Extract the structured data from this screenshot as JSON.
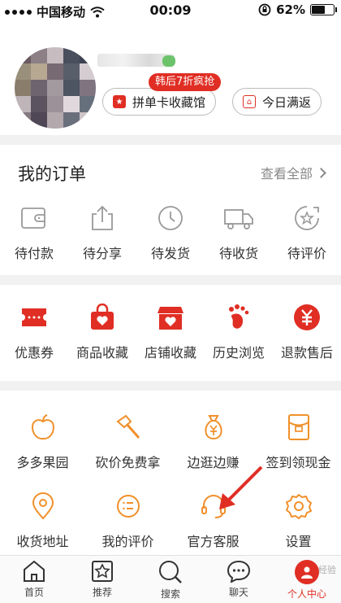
{
  "status_bar": {
    "carrier": "中国移动",
    "time": "00:09",
    "battery": "62%",
    "battery_level": 0.62
  },
  "profile": {
    "promo_tag": "韩后7折疯抢",
    "buttons": [
      {
        "label": "拼单卡收藏馆",
        "icon": "card-icon"
      },
      {
        "label": "今日满返",
        "icon": "gift-box-icon"
      }
    ]
  },
  "orders": {
    "title": "我的订单",
    "view_all": "查看全部",
    "items": [
      {
        "label": "待付款",
        "icon": "wallet-icon"
      },
      {
        "label": "待分享",
        "icon": "share-icon"
      },
      {
        "label": "待发货",
        "icon": "clock-icon"
      },
      {
        "label": "待收货",
        "icon": "truck-icon"
      },
      {
        "label": "待评价",
        "icon": "review-icon"
      }
    ]
  },
  "quick_links": [
    {
      "label": "优惠券",
      "icon": "coupon-icon"
    },
    {
      "label": "商品收藏",
      "icon": "bag-heart-icon"
    },
    {
      "label": "店铺收藏",
      "icon": "shop-heart-icon"
    },
    {
      "label": "历史浏览",
      "icon": "footprint-icon"
    },
    {
      "label": "退款售后",
      "icon": "refund-icon"
    }
  ],
  "services": [
    {
      "label": "多多果园",
      "icon": "apple-icon"
    },
    {
      "label": "砍价免费拿",
      "icon": "axe-icon"
    },
    {
      "label": "边逛边赚",
      "icon": "money-bag-icon"
    },
    {
      "label": "签到领现金",
      "icon": "red-envelope-icon"
    },
    {
      "label": "收货地址",
      "icon": "location-icon"
    },
    {
      "label": "我的评价",
      "icon": "comment-icon"
    },
    {
      "label": "官方客服",
      "icon": "headset-icon"
    },
    {
      "label": "设置",
      "icon": "gear-icon"
    }
  ],
  "tabbar": [
    {
      "label": "首页",
      "icon": "home-icon"
    },
    {
      "label": "推荐",
      "icon": "recommend-icon"
    },
    {
      "label": "搜索",
      "icon": "search-icon"
    },
    {
      "label": "聊天",
      "icon": "chat-icon"
    },
    {
      "label": "个人中心",
      "icon": "profile-icon",
      "active": true
    }
  ],
  "watermark": "经验",
  "colors": {
    "accent": "#e02e24",
    "orange": "#f0902a"
  }
}
